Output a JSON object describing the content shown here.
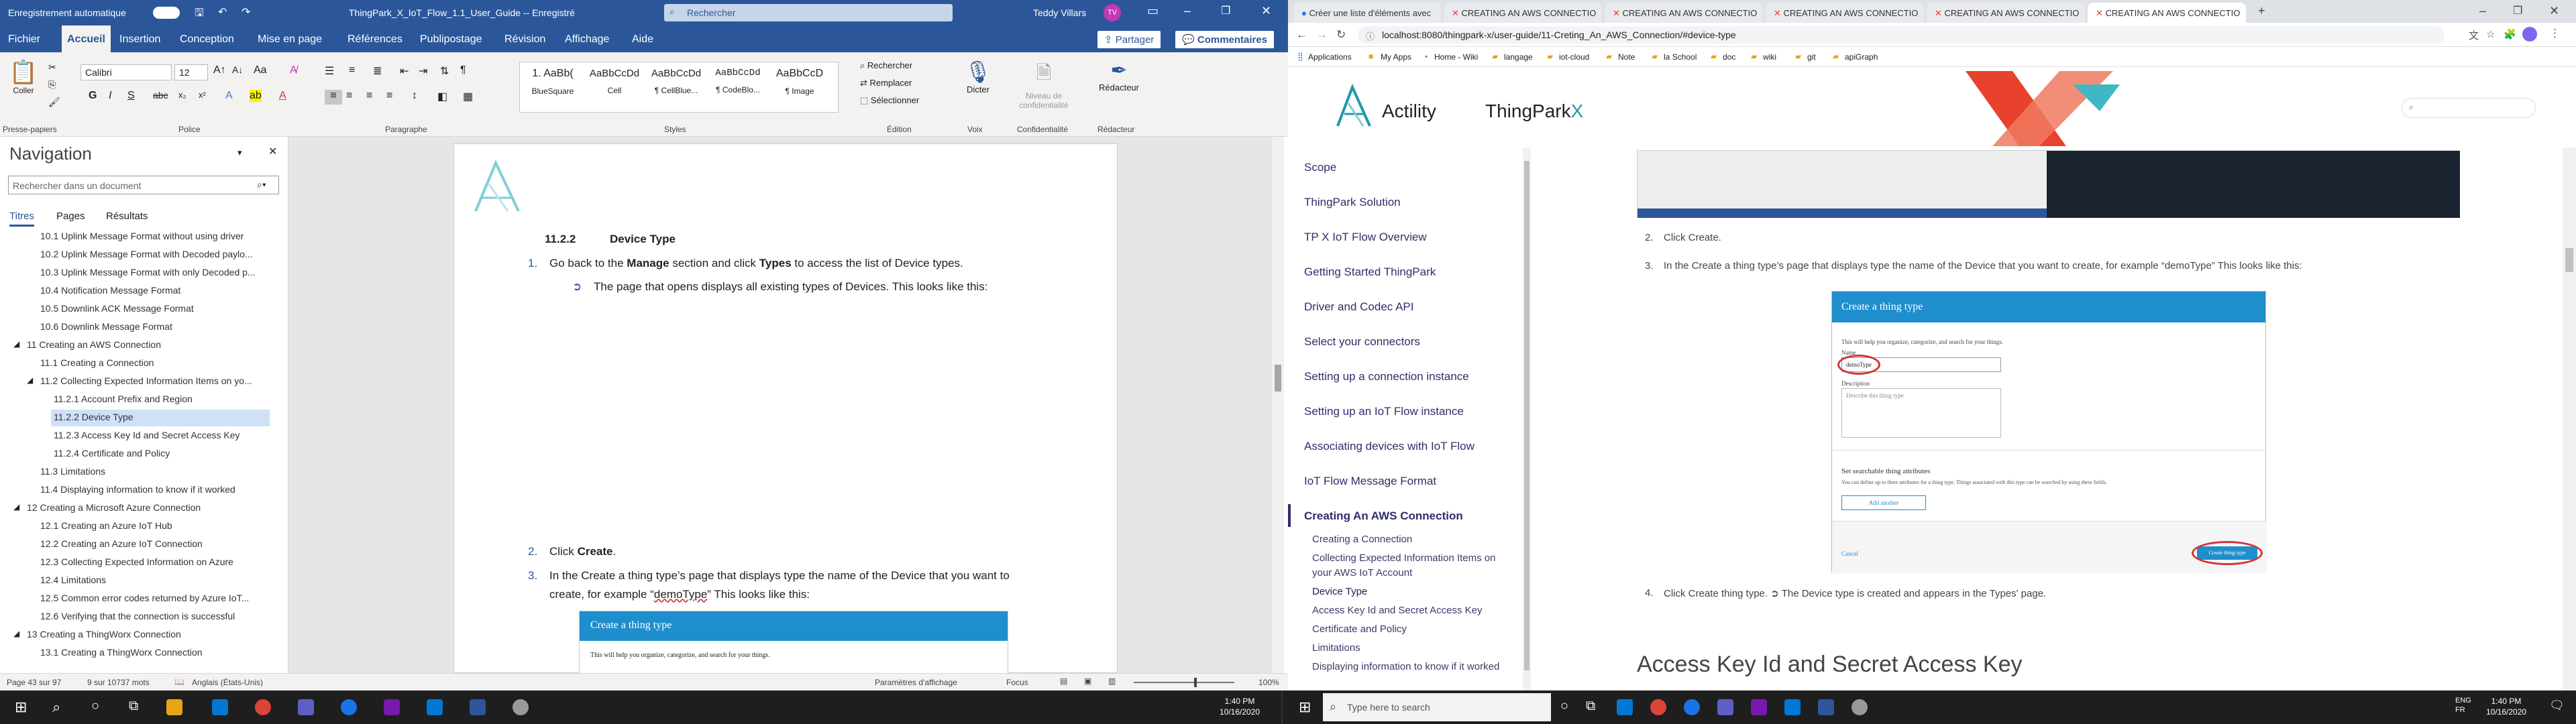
{
  "word": {
    "autosave_label": "Enregistrement automatique",
    "title": "ThingPark_X_IoT_Flow_1.1_User_Guide -- Enregistré",
    "search_placeholder": "Rechercher",
    "user": "Teddy Villars",
    "user_initials": "TV",
    "menu": [
      "Fichier",
      "Accueil",
      "Insertion",
      "Conception",
      "Mise en page",
      "Références",
      "Publipostage",
      "Révision",
      "Affichage",
      "Aide"
    ],
    "share": "Partager",
    "comments": "Commentaires",
    "font_name": "Calibri",
    "font_size": "12",
    "ribbon_groups": [
      "Presse-papiers",
      "Police",
      "Paragraphe",
      "Styles",
      "Édition",
      "Voix",
      "Confidentialité",
      "Rédacteur"
    ],
    "paste_label": "Coller",
    "styles": [
      {
        "preview": "1. AaBb(",
        "name": "BlueSquare"
      },
      {
        "preview": "AaBbCcDd",
        "name": "Cell"
      },
      {
        "preview": "AaBbCcDd",
        "name": "¶ CellBlue..."
      },
      {
        "preview": "AaBbCcDd",
        "name": "¶ CodeBlo..."
      },
      {
        "preview": "AaBbCcD",
        "name": "¶ Image"
      }
    ],
    "editing": [
      "Rechercher",
      "Remplacer",
      "Sélectionner"
    ],
    "dictate": "Dicter",
    "confidentiality": "Niveau de confidentialité",
    "editor": "Rédacteur",
    "nav": {
      "title": "Navigation",
      "search_placeholder": "Rechercher dans un document",
      "tabs": [
        "Titres",
        "Pages",
        "Résultats"
      ],
      "items": [
        "10.1 Uplink Message Format without using driver",
        "10.2 Uplink Message Format with Decoded paylo...",
        "10.3 Uplink Message Format with only Decoded p...",
        "10.4 Notification Message Format",
        "10.5 Downlink ACK Message Format",
        "10.6 Downlink Message Format",
        "11 Creating an AWS Connection",
        "11.1 Creating a Connection",
        "11.2 Collecting Expected Information Items on yo...",
        "11.2.1 Account Prefix and Region",
        "11.2.2 Device Type",
        "11.2.3 Access Key Id and Secret Access Key",
        "11.2.4 Certificate and Policy",
        "11.3 Limitations",
        "11.4 Displaying information to know if it worked",
        "12 Creating a Microsoft Azure Connection",
        "12.1 Creating an Azure IoT Hub",
        "12.2 Creating an Azure IoT Connection",
        "12.3 Collecting Expected Information on Azure",
        "12.4 Limitations",
        "12.5 Common error codes returned by Azure IoT...",
        "12.6 Verifying that the connection is successful",
        "13 Creating a ThingWorx Connection",
        "13.1 Creating a ThingWorx Connection"
      ]
    },
    "doc": {
      "heading_num": "11.2.2",
      "heading": "Device Type",
      "step1_prefix": "Go back to the ",
      "step1_b1": "Manage",
      "step1_mid": " section and click ",
      "step1_b2": "Types",
      "step1_suffix": " to access the list of Device types.",
      "step1_sub": "The page that opens displays all existing types of Devices. This looks like this:",
      "step2": "Click ",
      "step2_b": "Create",
      "step3_line1": "In the Create a thing type’s page that displays type the name of the Device that you want to",
      "step3_line2_a": "create, for example “",
      "step3_line2_b": "demoType",
      "step3_line2_c": "” This looks like this:",
      "thumb_title": "Create a thing type",
      "thumb_text": "This will help you organize, categorize, and search for your things."
    },
    "status": {
      "page": "Page 43 sur 97",
      "words": "9 sur 10737 mots",
      "lang": "Anglais (États-Unis)",
      "display": "Paramètres d'affichage",
      "focus": "Focus",
      "zoom": "100%"
    }
  },
  "browser": {
    "tabs": [
      "Créer une liste d'éléments avec",
      "CREATING AN AWS CONNECTIO",
      "CREATING AN AWS CONNECTIO",
      "CREATING AN AWS CONNECTIO",
      "CREATING AN AWS CONNECTIO",
      "CREATING AN AWS CONNECTIO"
    ],
    "url": "localhost:8080/thingpark-x/user-guide/11-Creting_An_AWS_Connection/#device-type",
    "bookmarks": [
      "Applications",
      "My Apps",
      "Home - Wiki",
      "langage",
      "iot-cloud",
      "Note",
      "la School",
      "doc",
      "wiki",
      "git",
      "apiGraph"
    ],
    "site": {
      "brand1": "Actility",
      "brand2": "ThingPark",
      "brand2_x": "X",
      "menu": [
        "Scope",
        "ThingPark Solution",
        "TP X IoT Flow Overview",
        "Getting Started ThingPark",
        "Driver and Codec API",
        "Select your connectors",
        "Setting up a connection instance",
        "Setting up an IoT Flow instance",
        "Associating devices with IoT Flow",
        "IoT Flow Message Format",
        "Creating An AWS Connection"
      ],
      "submenu": [
        "Creating a Connection",
        "Collecting Expected Information Items on",
        "your AWS IoT Account",
        "Device Type",
        "Access Key Id and Secret Access Key",
        "Certificate and Policy",
        "Limitations",
        "Displaying information to know if it worked"
      ],
      "step2": "Click Create.",
      "step3": "In the Create a thing type’s page that displays type the name of the Device that you want to create, for example “demoType” This looks like this:",
      "form": {
        "title": "Create a thing type",
        "intro": "This will help you organize, categorize, and search for your things.",
        "name_label": "Name",
        "name_value": "demoType",
        "desc_label": "Description",
        "desc_placeholder": "Describe this thing type",
        "attr_title": "Set searchable thing attributes",
        "attr_text": "You can define up to three attributes for a thing type. Things associated with this type can be searched by using these fields.",
        "add_another": "Add another",
        "cancel": "Cancel",
        "create": "Create thing type"
      },
      "step4": "Click Create thing type. ➲ The Device type is created and appears in the Types' page.",
      "next_heading": "Access Key Id and Secret Access Key"
    }
  },
  "taskbar": {
    "search_placeholder": "Type here to search",
    "time_left": "1:40 PM",
    "date_left": "10/16/2020",
    "time_right": "1:40 PM",
    "date_right": "10/16/2020",
    "lang": "ENG",
    "lang2": "FR"
  },
  "colors": {
    "word_blue": "#2b579a",
    "aws_blue": "#1f8ecc",
    "highlight_red": "#d13438",
    "thingpark_red": "#e8412c",
    "menu_text": "#2e2e6a"
  }
}
